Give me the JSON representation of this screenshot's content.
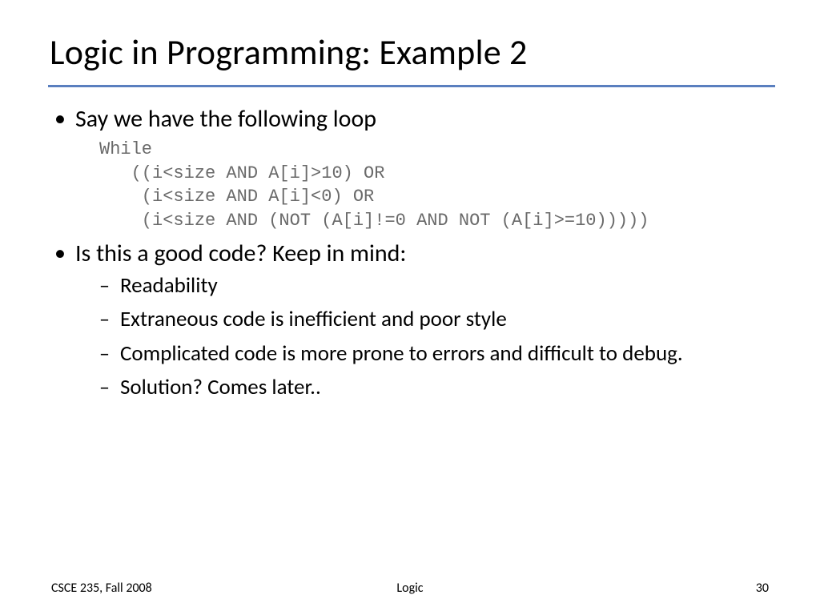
{
  "title": "Logic in Programming: Example 2",
  "bullets": {
    "b1": "Say we have the following loop",
    "b2": "Is this a good code? Keep in mind:",
    "sub": {
      "s1": "Readability",
      "s2": "Extraneous code is inefficient and poor style",
      "s3": "Complicated code is more prone to errors and difficult to debug.",
      "s4": "Solution?  Comes later.."
    }
  },
  "code": "While\n   ((i<size AND A[i]>10) OR\n    (i<size AND A[i]<0) OR\n    (i<size AND (NOT (A[i]!=0 AND NOT (A[i]>=10)))))",
  "footer": {
    "left": "CSCE 235, Fall 2008",
    "center": "Logic",
    "right": "30"
  }
}
